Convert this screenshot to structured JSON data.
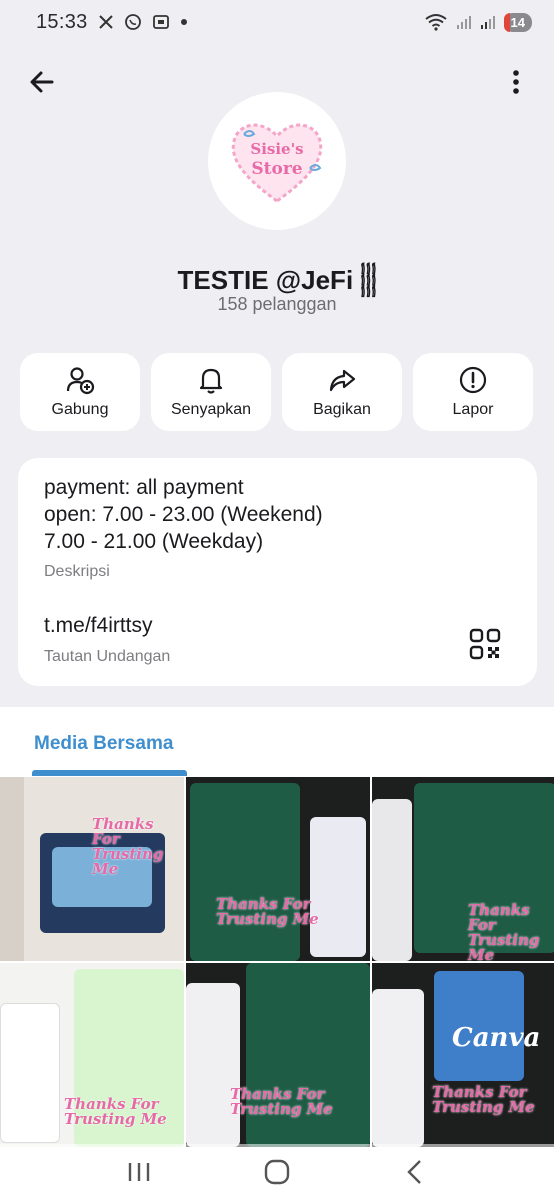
{
  "status": {
    "time": "15:33",
    "battery": "14"
  },
  "channel": {
    "name": "TESTIE @JeFi 𓂵",
    "subscribers": "158 pelanggan",
    "logo_lines": [
      "Sisie's",
      "Store"
    ]
  },
  "actions": [
    {
      "label": "Gabung",
      "icon": "add-user-icon"
    },
    {
      "label": "Senyapkan",
      "icon": "bell-icon"
    },
    {
      "label": "Bagikan",
      "icon": "share-icon"
    },
    {
      "label": "Lapor",
      "icon": "report-icon"
    }
  ],
  "info": {
    "description_lines": [
      "payment: all payment",
      "open: 7.00 - 23.00 (Weekend)",
      "7.00 - 21.00 (Weekday)"
    ],
    "description_caption": "Deskripsi",
    "link": "t.me/f4irttsy",
    "link_caption": "Tautan Undangan"
  },
  "media": {
    "tab_label": "Media Bersama",
    "thumb_text": [
      "Thanks For",
      "Trusting Me"
    ],
    "canva_label": "Canva"
  },
  "colors": {
    "accent": "#3f8fcf",
    "background": "#efeff3",
    "card": "#ffffff",
    "pink": "#e66aa7"
  }
}
